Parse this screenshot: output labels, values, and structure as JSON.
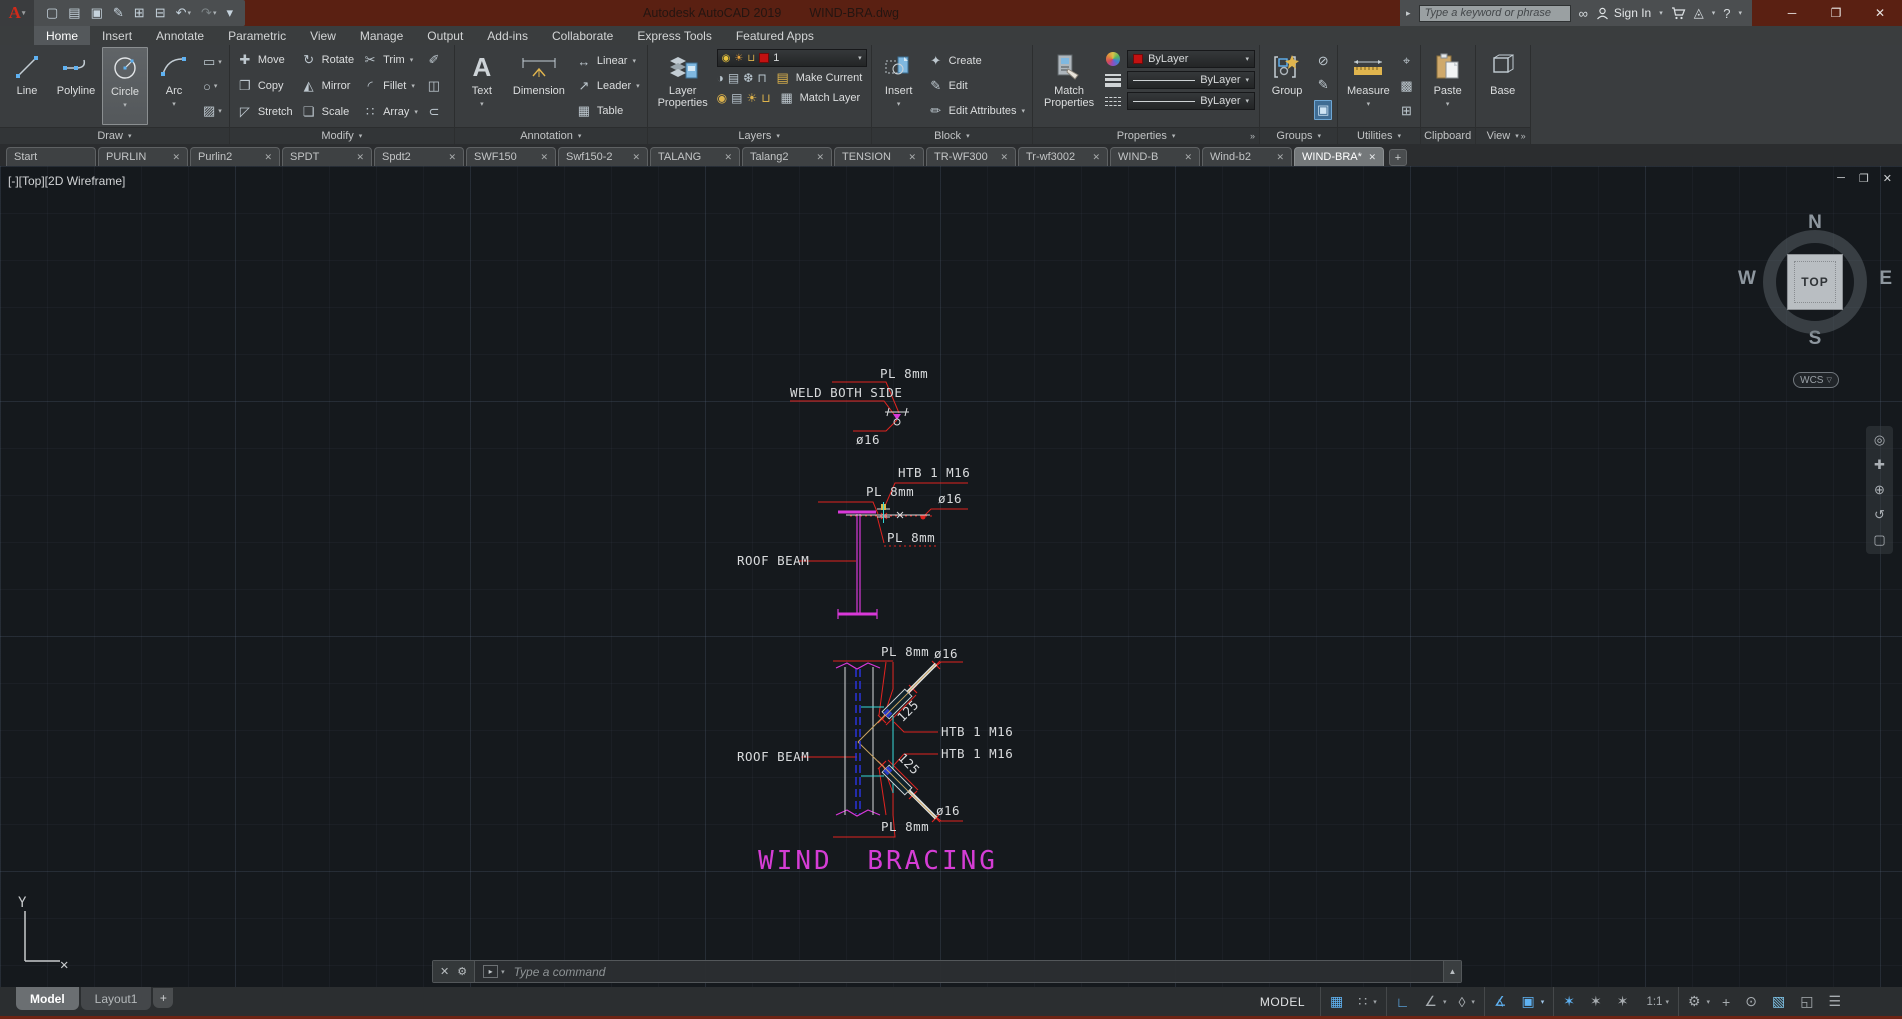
{
  "window": {
    "app_title": "Autodesk AutoCAD 2019",
    "doc_title": "WIND-BRA.dwg"
  },
  "infocenter": {
    "search_placeholder": "Type a keyword or phrase",
    "sign_in": "Sign In"
  },
  "qat": [
    {
      "name": "qat-new-icon",
      "glyph": "▢"
    },
    {
      "name": "qat-open-icon",
      "glyph": "▤"
    },
    {
      "name": "qat-save-icon",
      "glyph": "▣"
    },
    {
      "name": "qat-save-as-icon",
      "glyph": "✎"
    },
    {
      "name": "qat-plot-icon",
      "glyph": "⊞"
    },
    {
      "name": "qat-print-icon",
      "glyph": "⊟"
    },
    {
      "name": "qat-undo-icon",
      "glyph": "↶",
      "caret": true
    },
    {
      "name": "qat-redo-icon",
      "glyph": "↷",
      "caret": true,
      "cls": "dim"
    },
    {
      "name": "qat-customize-icon",
      "glyph": "▾"
    }
  ],
  "ribbon": {
    "tabs": [
      {
        "name": "tab-home",
        "label": "Home",
        "active": true
      },
      {
        "name": "tab-insert",
        "label": "Insert"
      },
      {
        "name": "tab-annotate",
        "label": "Annotate"
      },
      {
        "name": "tab-parametric",
        "label": "Parametric"
      },
      {
        "name": "tab-view",
        "label": "View"
      },
      {
        "name": "tab-manage",
        "label": "Manage"
      },
      {
        "name": "tab-output",
        "label": "Output"
      },
      {
        "name": "tab-addins",
        "label": "Add-ins"
      },
      {
        "name": "tab-collaborate",
        "label": "Collaborate"
      },
      {
        "name": "tab-express-tools",
        "label": "Express Tools"
      },
      {
        "name": "tab-featured-apps",
        "label": "Featured Apps"
      }
    ]
  },
  "panel_labels": {
    "draw": "Draw",
    "modify": "Modify",
    "annotation": "Annotation",
    "layers": "Layers",
    "block": "Block",
    "properties": "Properties",
    "groups": "Groups",
    "utilities": "Utilities",
    "clipboard": "Clipboard",
    "view": "View"
  },
  "draw": {
    "line": "Line",
    "polyline": "Polyline",
    "circle": "Circle",
    "arc": "Arc",
    "small": [
      {
        "name": "rectangle-tool-icon",
        "glyph": "▭",
        "caret": true
      },
      {
        "name": "ellipse-tool-icon",
        "glyph": "○",
        "caret": true
      },
      {
        "name": "hatch-tool-icon",
        "glyph": "▨",
        "caret": true
      }
    ]
  },
  "modify": {
    "items": [
      {
        "name": "move-button",
        "glyph": "✚",
        "label": "Move"
      },
      {
        "name": "rotate-button",
        "glyph": "↻",
        "label": "Rotate"
      },
      {
        "name": "trim-button",
        "glyph": "✂",
        "label": "Trim",
        "caret": true
      },
      {
        "name": "erase-button",
        "glyph": "✐",
        "label": ""
      },
      {
        "name": "copy-button",
        "glyph": "❐",
        "label": "Copy"
      },
      {
        "name": "mirror-button",
        "glyph": "◭",
        "label": "Mirror"
      },
      {
        "name": "fillet-button",
        "glyph": "◜",
        "label": "Fillet",
        "caret": true
      },
      {
        "name": "explode-button",
        "glyph": "◫",
        "label": ""
      },
      {
        "name": "stretch-button",
        "glyph": "◸",
        "label": "Stretch"
      },
      {
        "name": "scale-button",
        "glyph": "❏",
        "label": "Scale"
      },
      {
        "name": "array-button",
        "glyph": "∷",
        "label": "Array",
        "caret": true
      },
      {
        "name": "offset-button",
        "glyph": "⊂",
        "label": ""
      }
    ]
  },
  "annotation": {
    "text": "Text",
    "dimension": "Dimension",
    "items": [
      {
        "name": "linear-dimension-button",
        "glyph": "↔",
        "label": "Linear",
        "caret": true
      },
      {
        "name": "leader-button",
        "glyph": "↗",
        "label": "Leader",
        "caret": true
      },
      {
        "name": "table-button",
        "glyph": "▦",
        "label": "Table"
      }
    ]
  },
  "layers": {
    "layer_properties": "Layer Properties",
    "current_layer": "1",
    "make_current": "Make Current",
    "match_layer": "Match Layer",
    "tools1": [
      {
        "name": "layer-off-icon",
        "glyph": "◑"
      },
      {
        "name": "layer-isolate-icon",
        "glyph": "▤"
      },
      {
        "name": "layer-freeze-icon",
        "glyph": "❆"
      },
      {
        "name": "layer-lock-icon",
        "glyph": "⊓"
      }
    ],
    "tools2": [
      {
        "name": "layer-on-icon",
        "glyph": "◉",
        "cls": "gold"
      },
      {
        "name": "layer-unisolate-icon",
        "glyph": "▤"
      },
      {
        "name": "layer-thaw-icon",
        "glyph": "☀",
        "cls": "gold"
      },
      {
        "name": "layer-unlock-icon",
        "glyph": "⊔",
        "cls": "gold"
      }
    ]
  },
  "block": {
    "insert": "Insert",
    "items": [
      {
        "name": "create-block-button",
        "glyph": "✦",
        "label": "Create"
      },
      {
        "name": "edit-block-button",
        "glyph": "✎",
        "label": "Edit"
      },
      {
        "name": "edit-attributes-button",
        "glyph": "✏",
        "label": "Edit Attributes",
        "caret": true
      }
    ]
  },
  "properties": {
    "match_properties": "Match Properties",
    "bylayer": "ByLayer"
  },
  "groups": {
    "group": "Group",
    "icons": [
      {
        "name": "ungroup-icon",
        "glyph": "⊘"
      },
      {
        "name": "group-edit-icon",
        "glyph": "✎"
      },
      {
        "name": "group-selection-icon",
        "glyph": "▣",
        "cls": "on"
      }
    ]
  },
  "utilities": {
    "measure": "Measure",
    "icons": [
      {
        "name": "quick-select-icon",
        "glyph": "⌖"
      },
      {
        "name": "quick-calc-icon",
        "glyph": "▩"
      },
      {
        "name": "calculator-icon",
        "glyph": "⊞"
      }
    ]
  },
  "clipboard": {
    "paste": "Paste"
  },
  "view_panel": {
    "base": "Base"
  },
  "file_tabs": [
    {
      "name": "file-tab-start",
      "label": "Start"
    },
    {
      "name": "file-tab",
      "label": "PURLIN",
      "closable": true
    },
    {
      "name": "file-tab",
      "label": "Purlin2",
      "closable": true
    },
    {
      "name": "file-tab",
      "label": "SPDT",
      "closable": true
    },
    {
      "name": "file-tab",
      "label": "Spdt2",
      "closable": true
    },
    {
      "name": "file-tab",
      "label": "SWF150",
      "closable": true
    },
    {
      "name": "file-tab",
      "label": "Swf150-2",
      "closable": true
    },
    {
      "name": "file-tab",
      "label": "TALANG",
      "closable": true
    },
    {
      "name": "file-tab",
      "label": "Talang2",
      "closable": true
    },
    {
      "name": "file-tab",
      "label": "TENSION",
      "closable": true
    },
    {
      "name": "file-tab",
      "label": "TR-WF300",
      "closable": true
    },
    {
      "name": "file-tab",
      "label": "Tr-wf3002",
      "closable": true
    },
    {
      "name": "file-tab",
      "label": "WIND-B",
      "closable": true
    },
    {
      "name": "file-tab",
      "label": "Wind-b2",
      "closable": true
    },
    {
      "name": "file-tab",
      "label": "WIND-BRA*",
      "closable": true,
      "active": true
    }
  ],
  "viewport": {
    "header": "[-][Top][2D Wireframe]",
    "viewcube": {
      "n": "N",
      "s": "S",
      "w": "W",
      "e": "E",
      "top": "TOP"
    },
    "wcs": "WCS",
    "command_placeholder": "Type a command",
    "ucs": {
      "y": "Y",
      "x": "✕"
    },
    "navbar": [
      {
        "name": "navigation-wheel-icon",
        "glyph": "◎"
      },
      {
        "name": "pan-icon",
        "glyph": "✚"
      },
      {
        "name": "zoom-icon",
        "glyph": "⊕"
      },
      {
        "name": "orbit-icon",
        "glyph": "↺"
      },
      {
        "name": "showmotion-icon",
        "glyph": "▢"
      }
    ]
  },
  "drawing": {
    "pl8": "PL 8mm",
    "weld": "WELD BOTH SIDE",
    "dia16": "ø16",
    "htb": "HTB 1 M16",
    "roof_beam": "ROOF BEAM",
    "dim125": "125",
    "title": "WIND BRACING",
    "colors": {
      "red": "#e02420",
      "magenta": "#d939d9",
      "cyan": "#35d8d8",
      "blue": "#2b36e6",
      "white": "#d9dbdd",
      "tan": "#c9a462",
      "title_magenta": "#d53dd5"
    }
  },
  "layout_tabs": {
    "model": "Model",
    "layout1": "Layout1",
    "plus": "+"
  },
  "statusbar": {
    "model": "MODEL",
    "items": [
      {
        "name": "grid-display-toggle",
        "glyph": "▦",
        "cls": "on"
      },
      {
        "name": "snap-mode-toggle",
        "glyph": "∷",
        "caret": true
      },
      {
        "cls": "sep"
      },
      {
        "name": "ortho-mode-toggle",
        "glyph": "∟",
        "cls": "on"
      },
      {
        "name": "polar-tracking-toggle",
        "glyph": "∠",
        "caret": true
      },
      {
        "name": "isometric-drafting-toggle",
        "glyph": "◊",
        "caret": true
      },
      {
        "cls": "sep"
      },
      {
        "name": "osnap-tracking-toggle",
        "glyph": "∡",
        "cls": "on"
      },
      {
        "name": "object-snap-toggle",
        "glyph": "▣",
        "cls": "on",
        "caret": true
      },
      {
        "cls": "sep"
      },
      {
        "name": "annotation-visibility-toggle",
        "glyph": "✶",
        "cls": "on"
      },
      {
        "name": "annotation-autoscale-toggle",
        "glyph": "✶"
      },
      {
        "name": "annotation-scale-icon",
        "glyph": "✶"
      },
      {
        "name": "annotation-scale-value",
        "label": "1:1",
        "caret": true
      },
      {
        "cls": "sep"
      },
      {
        "name": "workspace-switching",
        "glyph": "⚙",
        "caret": true
      },
      {
        "name": "crosshair-toggle",
        "glyph": "+"
      },
      {
        "name": "isolate-objects-toggle",
        "glyph": "⊙"
      },
      {
        "name": "graphics-performance-toggle",
        "glyph": "▧",
        "cls": "perf"
      },
      {
        "name": "clean-screen-toggle",
        "glyph": "◱"
      },
      {
        "name": "customization-menu",
        "glyph": "☰"
      }
    ]
  }
}
